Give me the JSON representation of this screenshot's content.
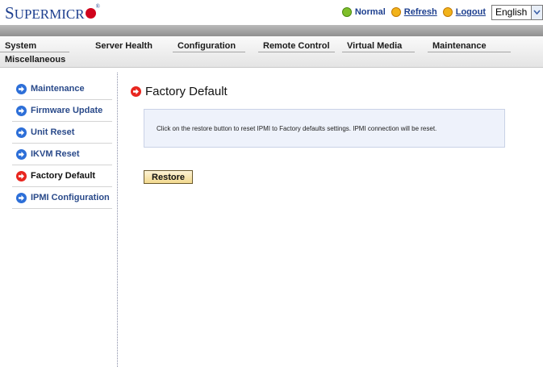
{
  "header": {
    "logo_text_main": "S",
    "logo_text_rest": "UPERMICR",
    "status": {
      "label": "Normal",
      "color": "#7fbf2a"
    },
    "refresh_label": "Refresh",
    "logout_label": "Logout",
    "language": {
      "selected": "English"
    }
  },
  "nav": {
    "items": [
      {
        "label": "System"
      },
      {
        "label": "Server Health"
      },
      {
        "label": "Configuration"
      },
      {
        "label": "Remote Control"
      },
      {
        "label": "Virtual Media"
      },
      {
        "label": "Maintenance"
      },
      {
        "label": "Miscellaneous"
      }
    ]
  },
  "sidebar": {
    "items": [
      {
        "label": "Maintenance",
        "icon": "blue-arrow-icon"
      },
      {
        "label": "Firmware Update",
        "icon": "blue-arrow-icon"
      },
      {
        "label": "Unit Reset",
        "icon": "blue-arrow-icon"
      },
      {
        "label": "IKVM Reset",
        "icon": "blue-arrow-icon"
      },
      {
        "label": "Factory Default",
        "icon": "red-arrow-icon",
        "active": true
      },
      {
        "label": "IPMI Configuration",
        "icon": "blue-arrow-icon"
      }
    ]
  },
  "main": {
    "title": "Factory Default",
    "info_text": "Click on the restore button to reset IPMI to Factory defaults settings. IPMI connection will be reset.",
    "restore_label": "Restore"
  },
  "colors": {
    "brand": "#1d3f8f",
    "accent_red": "#e8261f",
    "accent_blue": "#2d6fd8",
    "info_bg": "#eef2fb"
  }
}
